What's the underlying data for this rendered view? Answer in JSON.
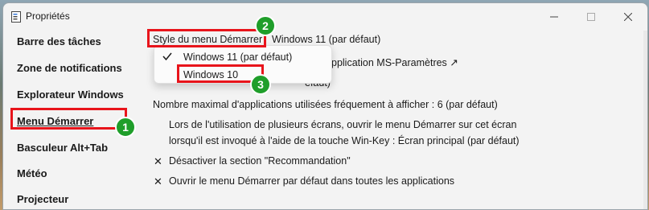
{
  "window": {
    "title": "Propriétés",
    "controls": {
      "minimize": "—",
      "maximize": "☐",
      "close": "✕"
    }
  },
  "sidebar": {
    "items": [
      {
        "label": "Barre des tâches"
      },
      {
        "label": "Zone de notifications"
      },
      {
        "label": "Explorateur Windows"
      },
      {
        "label": "Menu Démarrer",
        "selected": true
      },
      {
        "label": "Basculeur Alt+Tab"
      },
      {
        "label": "Météo"
      },
      {
        "label": "Projecteur"
      }
    ]
  },
  "main": {
    "style_label": "Style du menu Démarrer",
    "style_value": "Windows 11 (par défaut)",
    "row2_partial": "pplication MS-Paramètres ↗",
    "row3_partial": "éfaut)",
    "max_apps": "Nombre maximal d'applications utilisées fréquement à afficher : 6 (par défaut)",
    "multi_screen_line1": "Lors de l'utilisation de plusieurs écrans, ouvrir le menu Démarrer sur cet écran",
    "multi_screen_line2": "lorsqu'il est invoqué à l'aide de la touche Win-Key : Écran principal (par défaut)",
    "disable_recommendation": "Désactiver la section \"Recommandation\"",
    "open_default_all_apps": "Ouvrir le menu Démarrer par défaut dans toutes les applications",
    "check_mark": "✕"
  },
  "dropdown": {
    "options": [
      {
        "label": "Windows 11 (par défaut)",
        "checked": true
      },
      {
        "label": "Windows 10",
        "checked": false
      }
    ]
  },
  "annotations": {
    "badge1": "1",
    "badge2": "2",
    "badge3": "3",
    "highlight_color": "#e8141b",
    "badge_color": "#1f9e2a"
  }
}
